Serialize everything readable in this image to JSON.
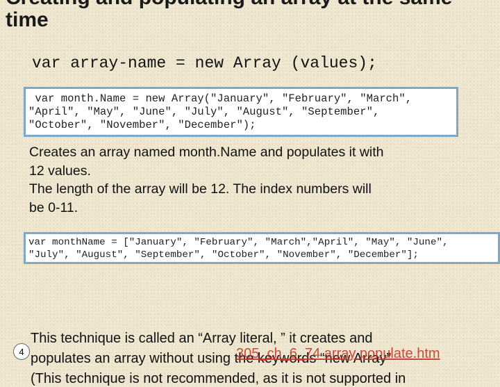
{
  "slide": {
    "title_line1": "Creating and populating an array at the same",
    "title_line2": "time",
    "syntax": "var array-name = new Array (values);",
    "bullet_glyph": "",
    "code_box_1": [
      " var month.Name = new Array(\"January\", \"February\", \"March\",",
      "\"April\", \"May\", \"June\", \"July\", \"August\", \"September\",",
      "\"October\", \"November\", \"December\");"
    ],
    "description": [
      "Creates an array named month.Name and populates it with",
      "12 values.",
      "The length of the array will be 12.  The index numbers will",
      "be 0-11."
    ],
    "code_box_2": [
      "var monthName = [\"January\", \"February\", \"March\",\"April\", \"May\", \"June\",",
      "\"July\", \"August\", \"September\", \"October\", \"November\", \"December\"];"
    ],
    "literal_lines": [
      "This technique is called an “Array literal, ” it creates and",
      "populates an array without using the keywords “new Array”",
      "(This technique is not recommended, as it is not supported in"
    ],
    "file_link": "305_ch_6_74 array populate.htm",
    "slide_number": "4"
  }
}
